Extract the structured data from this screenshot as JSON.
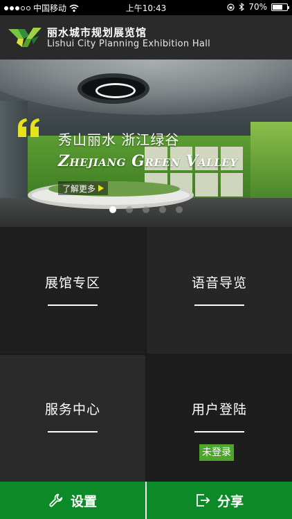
{
  "status_bar": {
    "carrier": "中国移动",
    "time": "上午10:43",
    "battery_text": "70%",
    "battery_level": 0.7
  },
  "header": {
    "title_cn": "丽水城市规划展览馆",
    "title_en": "Lishui City Planning Exhibition Hall"
  },
  "banner": {
    "title_cn": "秀山丽水  浙江绿谷",
    "title_en": "Zhejiang Green Valley",
    "more_label": "了解更多",
    "page_count": 5,
    "active_page": 1
  },
  "menu": {
    "items": [
      {
        "label": "展馆专区"
      },
      {
        "label": "语音导览"
      },
      {
        "label": "服务中心"
      },
      {
        "label": "用户登陆"
      }
    ],
    "login_status": "未登录"
  },
  "bottom_bar": {
    "settings_label": "设置",
    "share_label": "分享"
  },
  "colors": {
    "accent_green": "#0c8a27",
    "badge_green": "#4fa52c"
  }
}
